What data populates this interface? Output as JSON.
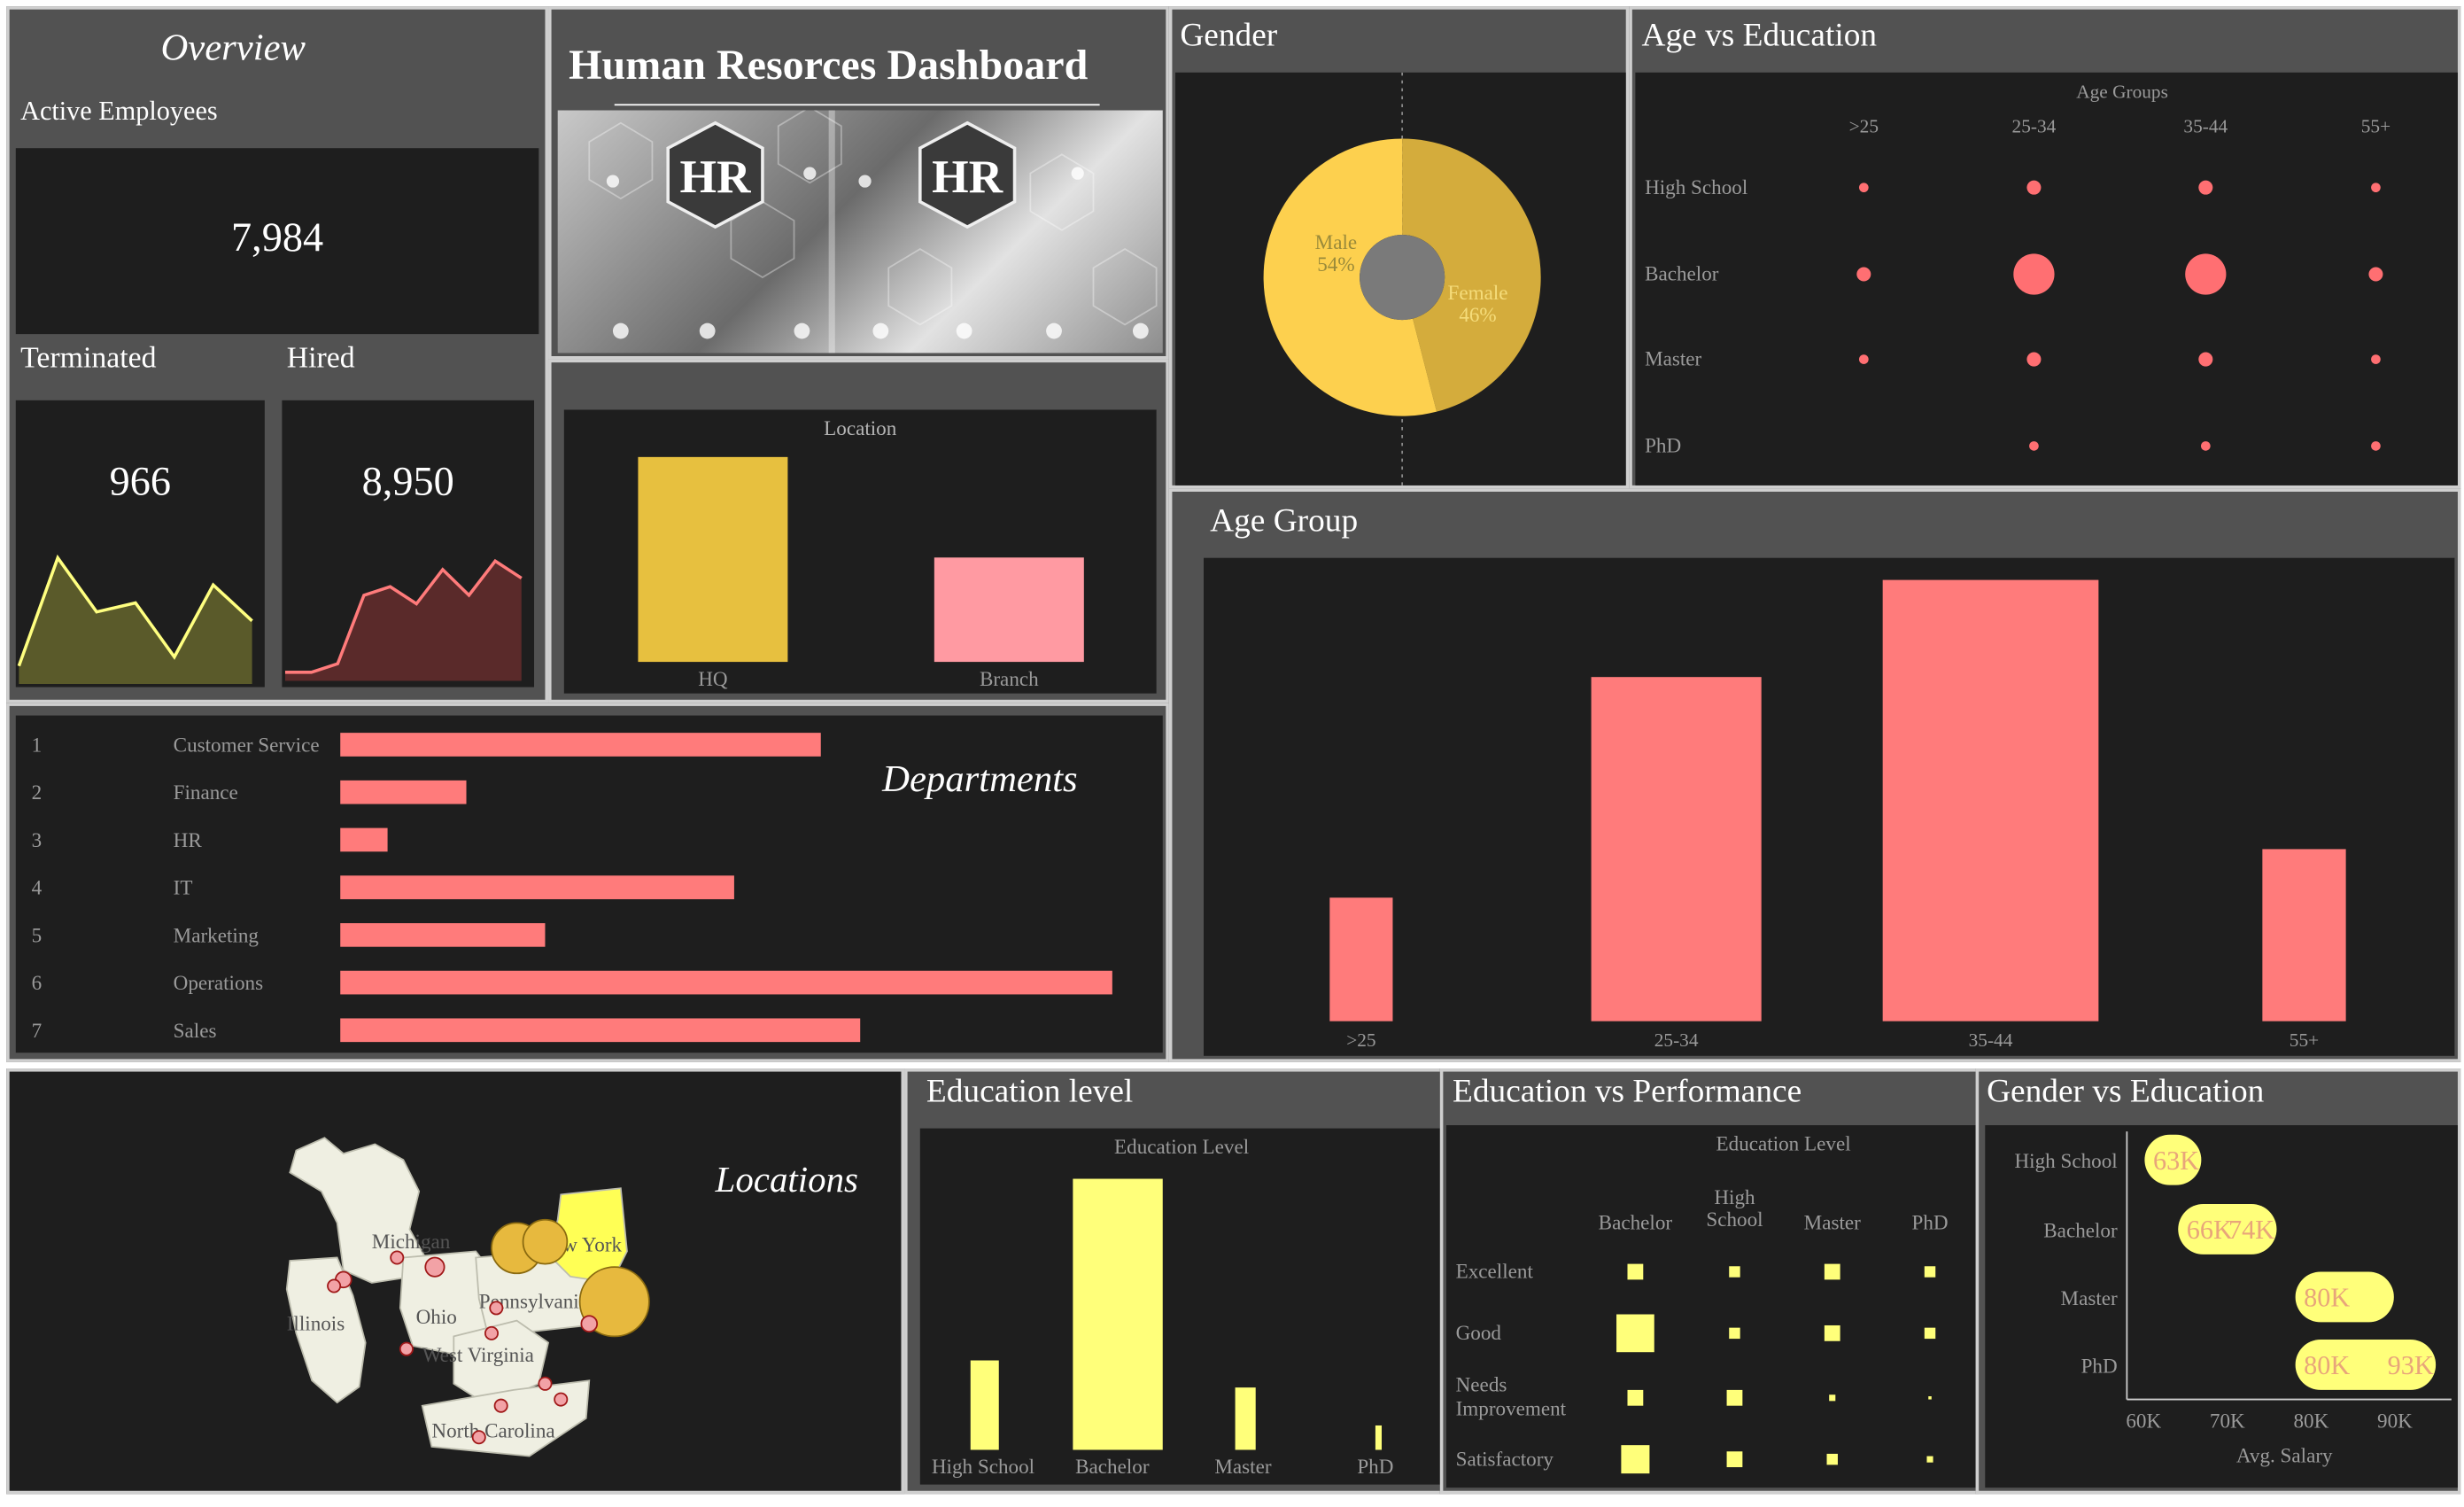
{
  "overview": {
    "title": "Overview",
    "active_label": "Active Employees",
    "active_value": "7,984",
    "terminated_label": "Terminated",
    "terminated_value": "966",
    "hired_label": "Hired",
    "hired_value": "8,950",
    "terminated_spark": [
      2,
      14,
      8,
      9,
      3,
      11,
      7
    ],
    "hired_spark": [
      1,
      1,
      2,
      10,
      11,
      9,
      13,
      10,
      14,
      12
    ]
  },
  "header": {
    "title": "Human Resorces Dashboard",
    "banner_icon": "hr-banner-image",
    "banner_text_1": "HR",
    "banner_text_2": "HR"
  },
  "location_chart": {
    "title": "Location",
    "categories": [
      "HQ",
      "Branch"
    ],
    "values": [
      5300,
      2700
    ],
    "colors": [
      "#e7c03f",
      "#ff9aa2"
    ]
  },
  "gender": {
    "title": "Gender",
    "slices": [
      {
        "label": "Male",
        "pct": "54%",
        "value": 54,
        "color": "#fdd04e"
      },
      {
        "label": "Female",
        "pct": "46%",
        "value": 46,
        "color": "#d4ac3c"
      }
    ]
  },
  "age_edu": {
    "title": "Age vs Education",
    "subtitle": "Age Groups",
    "columns": [
      ">25",
      "25-34",
      "35-44",
      "55+"
    ],
    "rows": [
      "High School",
      "Bachelor",
      "Master",
      "PhD"
    ],
    "sizes": [
      [
        1,
        2,
        2,
        1
      ],
      [
        2,
        4,
        4,
        2
      ],
      [
        1,
        2,
        2,
        1
      ],
      [
        0,
        1,
        1,
        1
      ]
    ]
  },
  "age_group": {
    "title": "Age Group",
    "categories": [
      ">25",
      "25-34",
      "35-44",
      "55+"
    ],
    "values": [
      28,
      78,
      100,
      39
    ],
    "bar_color": "#ff7b7b"
  },
  "departments": {
    "title": "Departments",
    "indexes": [
      "1",
      "2",
      "3",
      "4",
      "5",
      "6",
      "7"
    ],
    "names": [
      "Customer Service",
      "Finance",
      "HR",
      "IT",
      "Marketing",
      "Operations",
      "Sales"
    ],
    "values": [
      61,
      16,
      6,
      50,
      26,
      98,
      66
    ]
  },
  "locations_map": {
    "title": "Locations",
    "states": [
      "Michigan",
      "New York",
      "Illinois",
      "Ohio",
      "Pennsylvania",
      "West Virginia",
      "North Carolina"
    ]
  },
  "education_level": {
    "title": "Education level",
    "chart_title": "Education Level",
    "categories": [
      "High School",
      "Bachelor",
      "Master",
      "PhD"
    ],
    "values": [
      33,
      100,
      23,
      9
    ],
    "bar_color": "#ffff7a"
  },
  "edu_perf": {
    "title": "Education vs Performance",
    "subtitle": "Education Level",
    "columns": [
      "Bachelor",
      "High School",
      "Master",
      "PhD"
    ],
    "rows": [
      "Excellent",
      "Good",
      "Needs Improvement",
      "Satisfactory"
    ],
    "sizes": [
      [
        3,
        2,
        3,
        2
      ],
      [
        7,
        2,
        3,
        2
      ],
      [
        3,
        3,
        1,
        0
      ],
      [
        6,
        3,
        2,
        1
      ]
    ]
  },
  "gender_edu": {
    "title": "Gender vs Education",
    "rows": [
      "High School",
      "Bachelor",
      "Master",
      "PhD"
    ],
    "xlabel": "Avg. Salary",
    "ticks": [
      "60K",
      "70K",
      "80K",
      "90K"
    ],
    "labels": [
      [
        "63K"
      ],
      [
        "66K",
        "74K"
      ],
      [
        "80K"
      ],
      [
        "80K",
        "93K"
      ]
    ],
    "ranges": [
      [
        62,
        65
      ],
      [
        66,
        74
      ],
      [
        80,
        88
      ],
      [
        80,
        93
      ]
    ]
  }
}
